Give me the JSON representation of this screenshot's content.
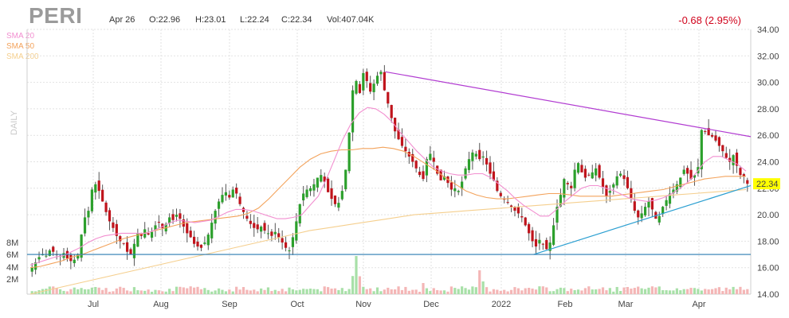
{
  "header": {
    "ticker": "PERI",
    "date": "Apr 26",
    "open": "O:22.96",
    "high": "H:23.01",
    "low": "L:22.24",
    "close": "C:22.34",
    "volume": "Vol:407.04K",
    "change": "-0.68 (2.95%)",
    "period": "DAILY"
  },
  "legend": [
    {
      "label": "SMA 20",
      "color": "#f28fd0"
    },
    {
      "label": "SMA 50",
      "color": "#f3a35c"
    },
    {
      "label": "SMA 200",
      "color": "#f5cf8e"
    }
  ],
  "colors": {
    "up": "#2ca02c",
    "down": "#c0141c",
    "vol_up": "#a8e0a8",
    "vol_down": "#f4b6b6",
    "trend_resistance": "#b13bd1",
    "trend_support": "#2b9fd1",
    "support_line": "#2a7bb0",
    "price_badge": "#ffff00"
  },
  "chart_data": {
    "type": "candlestick",
    "ylim": [
      14,
      34
    ],
    "y_ticks": [
      "14.00",
      "16.00",
      "18.00",
      "20.00",
      "22.00",
      "24.00",
      "26.00",
      "28.00",
      "30.00",
      "32.00",
      "34.00"
    ],
    "x_labels": [
      "Jul",
      "Aug",
      "Sep",
      "Oct",
      "Nov",
      "Dec",
      "2022",
      "Feb",
      "Mar",
      "Apr"
    ],
    "volume_ticks": [
      "2M",
      "4M",
      "6M",
      "8M"
    ],
    "last_price": "22.34",
    "close_series": [
      16.0,
      16.4,
      16.8,
      17.0,
      16.9,
      17.3,
      17.2,
      17.0,
      16.9,
      17.1,
      16.7,
      16.5,
      16.6,
      17.0,
      18.5,
      19.8,
      20.3,
      21.9,
      22.3,
      21.8,
      21.0,
      20.2,
      19.5,
      19.0,
      18.4,
      18.0,
      17.8,
      17.2,
      17.0,
      17.8,
      18.6,
      18.4,
      18.9,
      18.5,
      18.7,
      19.2,
      19.4,
      19.0,
      19.3,
      19.8,
      19.6,
      20.0,
      19.7,
      19.1,
      18.6,
      18.3,
      17.8,
      17.6,
      17.5,
      17.9,
      18.5,
      19.4,
      20.3,
      21.0,
      21.5,
      21.7,
      21.3,
      21.9,
      21.6,
      20.8,
      20.2,
      19.7,
      19.3,
      19.0,
      18.9,
      19.1,
      18.8,
      18.6,
      18.4,
      18.7,
      18.3,
      17.9,
      17.5,
      17.3,
      18.3,
      19.5,
      20.8,
      21.6,
      21.9,
      22.0,
      22.3,
      22.8,
      23.0,
      22.5,
      21.7,
      21.2,
      20.8,
      20.9,
      21.8,
      23.4,
      26.2,
      29.4,
      30.1,
      29.2,
      30.7,
      30.1,
      29.3,
      29.9,
      30.5,
      30.8,
      29.4,
      28.4,
      27.3,
      26.3,
      25.7,
      25.2,
      24.8,
      24.4,
      24.0,
      23.5,
      23.0,
      22.7,
      24.2,
      24.6,
      24.0,
      23.1,
      22.6,
      22.9,
      22.4,
      21.9,
      22.0,
      21.8,
      22.5,
      23.5,
      24.2,
      24.7,
      24.6,
      24.2,
      24.4,
      23.8,
      23.1,
      22.6,
      21.8,
      21.4,
      21.2,
      20.9,
      20.6,
      20.3,
      20.1,
      19.8,
      19.2,
      18.6,
      18.0,
      17.6,
      18.1,
      17.8,
      17.4,
      17.9,
      19.2,
      20.6,
      21.5,
      22.7,
      22.3,
      22.0,
      23.4,
      23.9,
      23.2,
      22.8,
      23.0,
      23.2,
      23.5,
      22.8,
      22.1,
      21.4,
      21.8,
      22.3,
      22.9,
      23.1,
      22.7,
      22.0,
      21.2,
      20.3,
      19.8,
      20.1,
      20.6,
      21.0,
      20.4,
      19.7,
      19.9,
      20.6,
      21.1,
      21.6,
      21.9,
      22.3,
      22.8,
      23.4,
      23.1,
      22.7,
      23.0,
      23.6,
      26.4,
      26.3,
      26.0,
      25.9,
      25.6,
      25.2,
      24.8,
      24.3,
      24.0,
      24.5,
      23.7,
      23.0,
      22.9,
      22.34
    ],
    "sma20": [
      16.2,
      16.4,
      16.6,
      16.8,
      16.9,
      17.2,
      17.5,
      17.9,
      18.2,
      18.4,
      18.5,
      18.6,
      18.6,
      18.6,
      18.6,
      18.8,
      19.1,
      19.4,
      19.6,
      19.5,
      19.4,
      19.5,
      19.6,
      19.9,
      20.2,
      20.4,
      20.4,
      20.3,
      20.1,
      19.9,
      19.7,
      19.7,
      19.8,
      20.0,
      20.7,
      21.4,
      22.7,
      24.2,
      25.7,
      26.9,
      27.7,
      28.1,
      28.0,
      27.6,
      27.0,
      26.2,
      25.5,
      24.8,
      24.2,
      23.6,
      23.3,
      23.1,
      23.0,
      23.0,
      23.1,
      23.1,
      22.8,
      22.3,
      21.8,
      21.2,
      20.7,
      20.3,
      19.9,
      19.9,
      20.4,
      21.0,
      21.5,
      22.0,
      22.2,
      22.2,
      22.0,
      21.8,
      21.5,
      21.2,
      21.1,
      21.0,
      21.1,
      21.3,
      21.6,
      22.0,
      22.5,
      23.2,
      24.0,
      24.4,
      24.4,
      24.1,
      23.8,
      23.3
    ],
    "sma50": [
      16.0,
      16.1,
      16.3,
      16.5,
      16.8,
      17.0,
      17.3,
      17.6,
      17.9,
      18.2,
      18.4,
      18.6,
      18.8,
      19.0,
      19.2,
      19.4,
      19.5,
      19.6,
      19.7,
      19.8,
      19.9,
      20.1,
      20.5,
      21.2,
      22.0,
      22.8,
      23.6,
      24.2,
      24.6,
      24.8,
      24.9,
      24.9,
      25.0,
      25.0,
      25.1,
      25.0,
      24.8,
      24.4,
      23.9,
      23.4,
      22.8,
      22.3,
      21.8,
      21.5,
      21.3,
      21.2,
      21.2,
      21.3,
      21.4,
      21.5,
      21.6,
      21.6,
      21.5,
      21.4,
      21.4,
      21.4,
      21.4,
      21.5,
      21.6,
      21.7,
      21.8,
      21.9,
      22.1,
      22.3,
      22.5,
      22.7,
      22.8,
      22.9,
      22.9,
      22.9
    ],
    "sma200": [
      14.0,
      14.3,
      14.6,
      14.9,
      15.2,
      15.5,
      15.8,
      16.1,
      16.4,
      16.7,
      17.0,
      17.3,
      17.6,
      17.9,
      18.2,
      18.5,
      18.8,
      19.0,
      19.2,
      19.4,
      19.6,
      19.8,
      20.0,
      20.1,
      20.2,
      20.3,
      20.4,
      20.5,
      20.6,
      20.7,
      20.8,
      20.9,
      21.0,
      21.1,
      21.2,
      21.3,
      21.4,
      21.5,
      21.6,
      21.7,
      21.8,
      21.9
    ],
    "trendlines": [
      {
        "name": "resistance",
        "from": [
          0.495,
          30.8
        ],
        "to": [
          1.0,
          25.9
        ]
      },
      {
        "name": "support",
        "from": [
          0.7,
          17.0
        ],
        "to": [
          1.0,
          22.2
        ]
      },
      {
        "name": "horizontal-support",
        "from": [
          0.0,
          17.0
        ],
        "to": [
          1.0,
          17.0
        ]
      }
    ]
  }
}
